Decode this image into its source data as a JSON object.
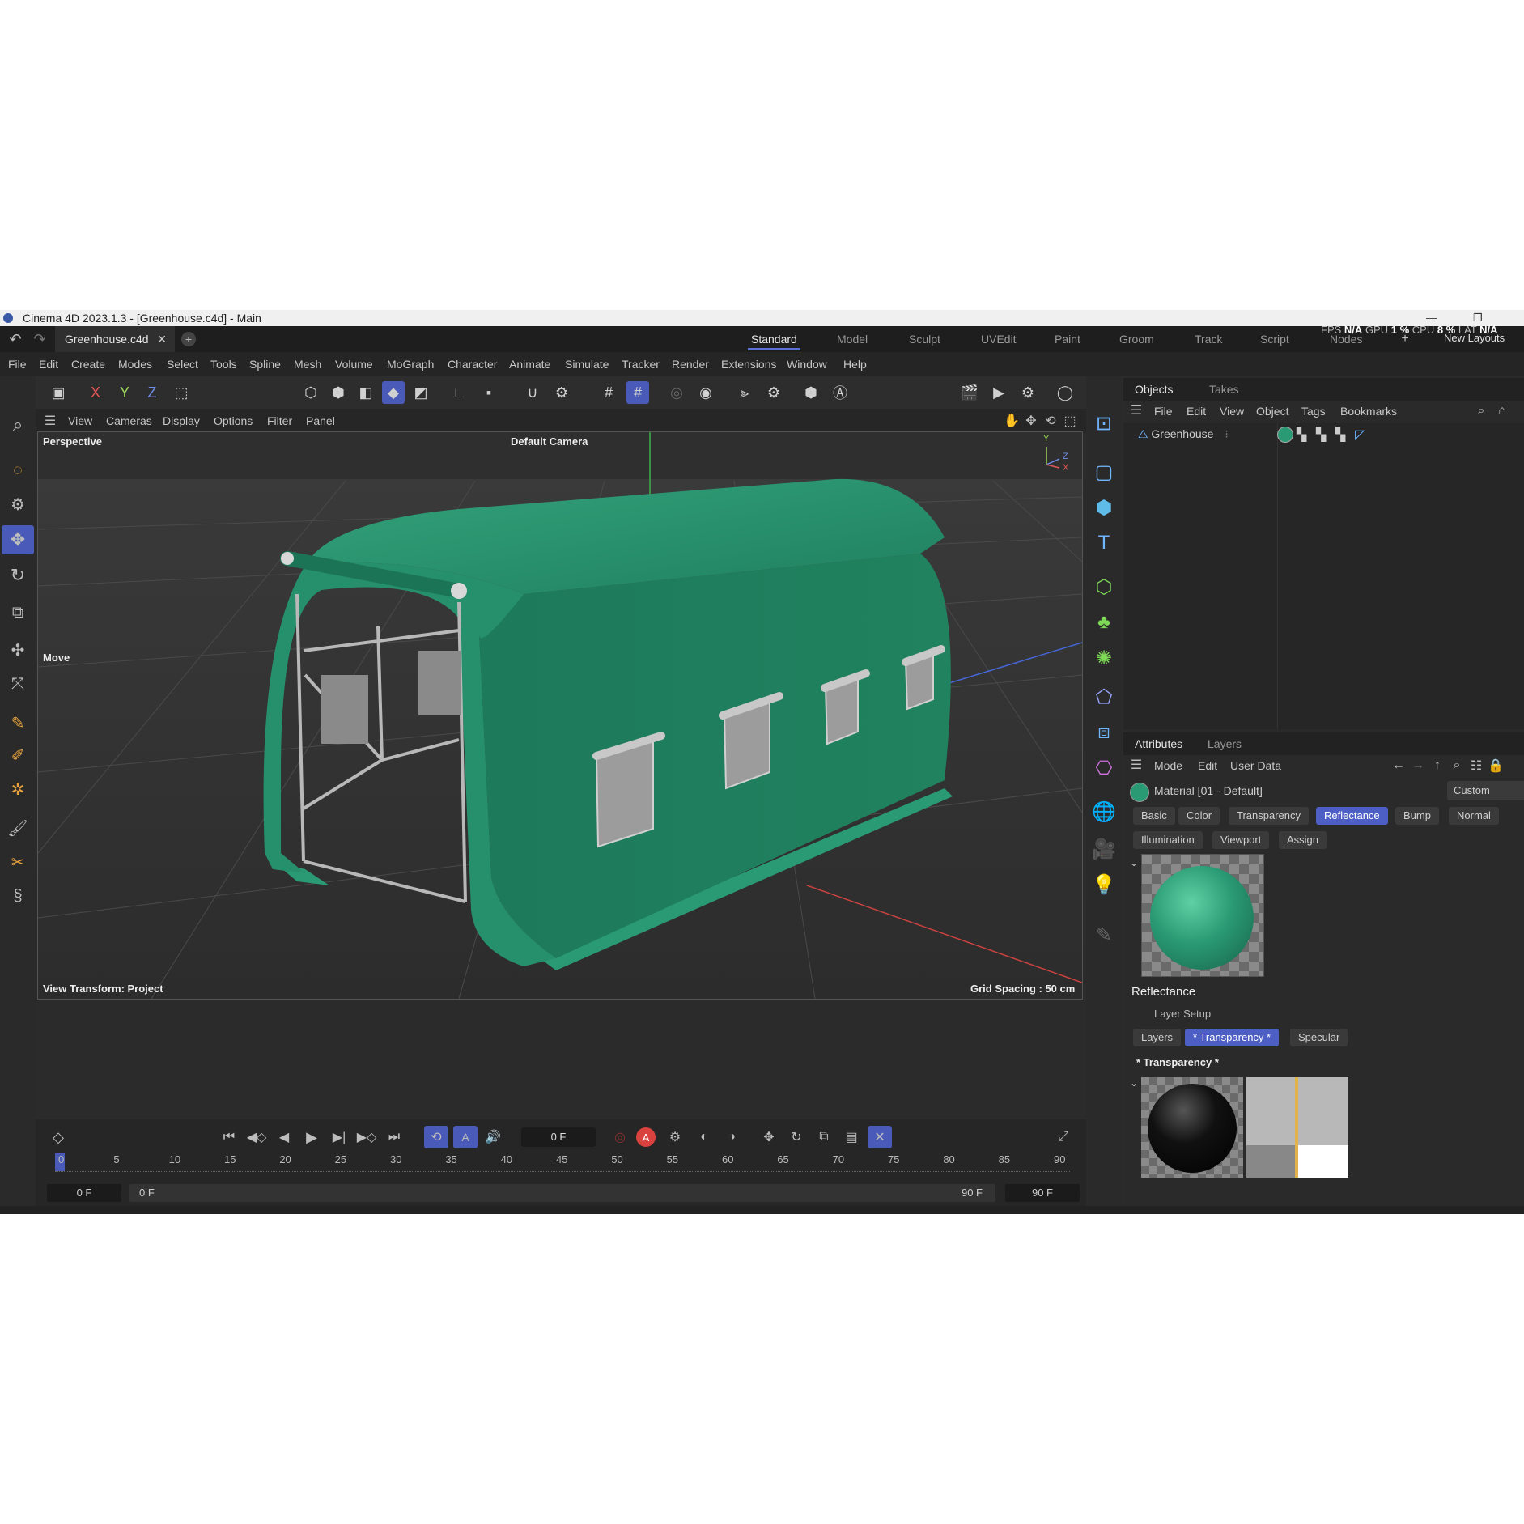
{
  "window": {
    "title": "Cinema 4D 2023.1.3 - [Greenhouse.c4d] - Main",
    "document_tab": "Greenhouse.c4d",
    "layouts": [
      "Standard",
      "Model",
      "Sculpt",
      "UVEdit",
      "Paint",
      "Groom",
      "Track",
      "Script",
      "Nodes"
    ],
    "active_layout": "Standard",
    "new_layouts": "New Layouts",
    "perf": {
      "fps_label": "FPS",
      "fps": "N/A",
      "gpu_label": "GPU",
      "gpu": "1 %",
      "cpu_label": "CPU",
      "cpu": "8 %",
      "lat_label": "LAT",
      "lat": "N/A"
    }
  },
  "menubar": [
    "File",
    "Edit",
    "Create",
    "Modes",
    "Select",
    "Tools",
    "Spline",
    "Mesh",
    "Volume",
    "MoGraph",
    "Character",
    "Animate",
    "Simulate",
    "Tracker",
    "Render",
    "Extensions",
    "Window",
    "Help"
  ],
  "viewport_menu": [
    "View",
    "Cameras",
    "Display",
    "Options",
    "Filter",
    "Panel"
  ],
  "viewport": {
    "projection": "Perspective",
    "camera": "Default Camera",
    "tool": "Move",
    "view_transform": "View Transform: Project",
    "grid_spacing": "Grid Spacing : 50 cm",
    "axis_y": "Y",
    "axis_z": "Z",
    "axis_x": "X",
    "model_color": "#2a9a74"
  },
  "objects_panel": {
    "tabs": [
      "Objects",
      "Takes"
    ],
    "menu": [
      "File",
      "Edit",
      "View",
      "Object",
      "Tags",
      "Bookmarks"
    ],
    "object_name": "Greenhouse"
  },
  "attributes_panel": {
    "tabs": [
      "Attributes",
      "Layers"
    ],
    "menu": [
      "Mode",
      "Edit",
      "User Data"
    ],
    "material_name": "Material [01 - Default]",
    "preset": "Custom",
    "channel_tabs_row1": [
      "Basic",
      "Color",
      "Transparency",
      "Reflectance",
      "Bump",
      "Normal"
    ],
    "channel_tabs_row2": [
      "Illumination",
      "Viewport",
      "Assign"
    ],
    "active_channel": "Reflectance",
    "section_title": "Reflectance",
    "layer_setup": "Layer Setup",
    "layer_buttons": [
      "Layers",
      "* Transparency *",
      "Specular"
    ],
    "active_layer_button": "* Transparency *",
    "layer_title": "* Transparency *"
  },
  "timeline": {
    "current_frame": "0 F",
    "ticks": [
      "0",
      "5",
      "10",
      "15",
      "20",
      "25",
      "30",
      "35",
      "40",
      "45",
      "50",
      "55",
      "60",
      "65",
      "70",
      "75",
      "80",
      "85",
      "90"
    ],
    "range_start": "0 F",
    "range_inner_start": "0 F",
    "range_inner_end": "90 F",
    "range_end": "90 F"
  },
  "colors": {
    "accent": "#4d5fc4",
    "green": "#2a9a74"
  }
}
